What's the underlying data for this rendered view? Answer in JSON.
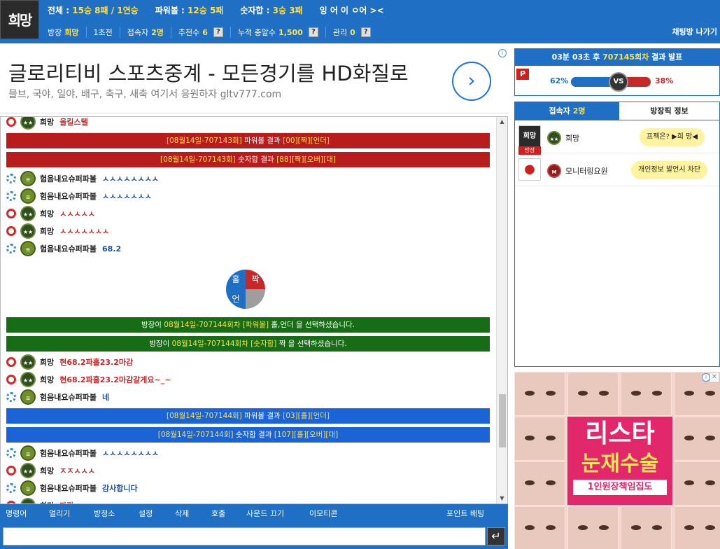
{
  "header": {
    "logo": "희망",
    "stats": [
      {
        "label": "전체 :",
        "value": "15승 8패 / 1연승"
      },
      {
        "label": "파워볼 :",
        "value": "12승 5패"
      },
      {
        "label": "숫자합 :",
        "value": "3승 3패"
      }
    ],
    "marquee": "잉 어 이 ㅇ어 ><",
    "info": {
      "owner_label": "방장",
      "owner_value": "희망",
      "rank": "1초전",
      "users_label": "접속자",
      "users_value": "2명",
      "recommend_label": "추천수",
      "recommend_value": "6",
      "earnings_label": "누적 충알수",
      "earnings_value": "1,500",
      "manage_label": "관리",
      "manage_value": "0",
      "help": "?"
    },
    "exit_label": "채팅방 나가기"
  },
  "ad_banner": {
    "title": "글로리티비 스포츠중계 - 모든경기를 HD화질로",
    "subtitle": "믈브, 국야, 일야, 배구, 축구, 새축 여기서 응원하자 gltv777.com",
    "arrow": "›",
    "info": "i"
  },
  "chat": {
    "messages": [
      {
        "role": "red",
        "rank": "star",
        "nick": "희망",
        "text": "올킬스텔",
        "color": "red"
      },
      {
        "bar": "red",
        "pre": "[08월14일-707143회]",
        "mid": " 파워볼 결과 ",
        "post": "[00][짝][언더]"
      },
      {
        "bar": "red",
        "pre": "[08월14일-707143회]",
        "mid": " 숫자합 결과 ",
        "post": "[88][짝][오버][대]"
      },
      {
        "role": "blue",
        "rank": "chev",
        "nick": "험음내요슈퍼파볼",
        "text": "ㅅㅅㅅㅅㅅㅅㅅㅅ",
        "color": "blue"
      },
      {
        "role": "blue",
        "rank": "chev",
        "nick": "험음내요슈퍼파볼",
        "text": "ㅅㅅㅅㅅㅅㅅㅅ",
        "color": "blue"
      },
      {
        "role": "red",
        "rank": "star",
        "nick": "희망",
        "text": "ㅅㅅㅅㅅㅅ",
        "color": "red"
      },
      {
        "role": "red",
        "rank": "star",
        "nick": "희망",
        "text": "ㅅㅅㅅㅅㅅㅅㅅ",
        "color": "red"
      },
      {
        "role": "blue",
        "rank": "chev",
        "nick": "험음내요슈퍼파볼",
        "text": "68.2",
        "color": "blue"
      },
      {
        "bar": "green",
        "pre": "방장이 ",
        "y1": "08월14일-707144회차",
        "mid": " [파워볼] ",
        "post": "홀,언더 을 선택하셨습니다."
      },
      {
        "bar": "green",
        "pre": "방장이 ",
        "y1": "08월14일-707144회차",
        "mid": " [숫자합] ",
        "post": "짝 을 선택하셨습니다."
      },
      {
        "role": "red",
        "rank": "star",
        "nick": "희망",
        "text": "현68.2파홀23.2마감",
        "color": "red"
      },
      {
        "role": "red",
        "rank": "star",
        "nick": "희망",
        "text": "현68.2파홀23.2마감갈게요~_~",
        "color": "red"
      },
      {
        "role": "blue",
        "rank": "chev",
        "nick": "험음내요슈퍼파볼",
        "text": "네",
        "color": "blue"
      },
      {
        "bar": "blue",
        "pre": "[08월14일-707144회]",
        "mid": " 파워볼 결과 ",
        "post": "[03][홀][언더]"
      },
      {
        "bar": "blue",
        "pre": "[08월14일-707144회]",
        "mid": " 숫자합 결과 ",
        "post": "[107][홀][오버][대]"
      },
      {
        "role": "blue",
        "rank": "chev",
        "nick": "험음내요슈퍼파볼",
        "text": "ㅅㅅㅅㅅㅅㅅㅅㅅ",
        "color": "blue"
      },
      {
        "role": "red",
        "rank": "star",
        "nick": "희망",
        "text": "ㅈㅈㅅㅅㅅ",
        "color": "red"
      },
      {
        "role": "blue",
        "rank": "chev",
        "nick": "험음내요슈퍼파볼",
        "text": "감사합니다",
        "color": "blue"
      },
      {
        "role": "red",
        "rank": "star",
        "nick": "희망",
        "text": "마감",
        "color": "red"
      }
    ],
    "pick": {
      "odd": "홀",
      "even": "짝",
      "under": "언"
    },
    "rank_star_glyph": "★★",
    "rank_chev_glyph": "≋"
  },
  "toolbar": {
    "items": [
      "명령어",
      "얼리기",
      "방청소",
      "설정",
      "삭제",
      "호출",
      "사운드 끄기",
      "이모티콘"
    ],
    "point": "포인트 배팅",
    "input_placeholder": "",
    "send": "↵"
  },
  "result": {
    "prefix": "03분 03초 후 ",
    "round": "707145회차",
    "suffix": " 결과 발표",
    "badge": "P",
    "left_pct": "62%",
    "right_pct": "38%",
    "left_fraction": 0.62,
    "vs": "VS"
  },
  "users": {
    "tab_users_label": "접속자",
    "tab_users_count": "2명",
    "tab_room": "방장픽 정보",
    "list": [
      {
        "avatar": "희망",
        "badge": "방장",
        "rank": "★★",
        "nick": "희망",
        "bubble": "프젝은? ▶희 망◀"
      },
      {
        "avatar": "●",
        "badge": "",
        "rank": "M",
        "nick": "모니터링요원",
        "bubble": "개인정보 발언시 차단"
      }
    ]
  },
  "side_ad": {
    "line1": "리스타",
    "line2": "눈재수술",
    "line3": "1인원장책임집도",
    "info": "i",
    "close": "✕"
  },
  "colors": {
    "primary": "#1f6fc4",
    "accent": "#ffe24a",
    "red": "#c62828",
    "green": "#166d16"
  }
}
